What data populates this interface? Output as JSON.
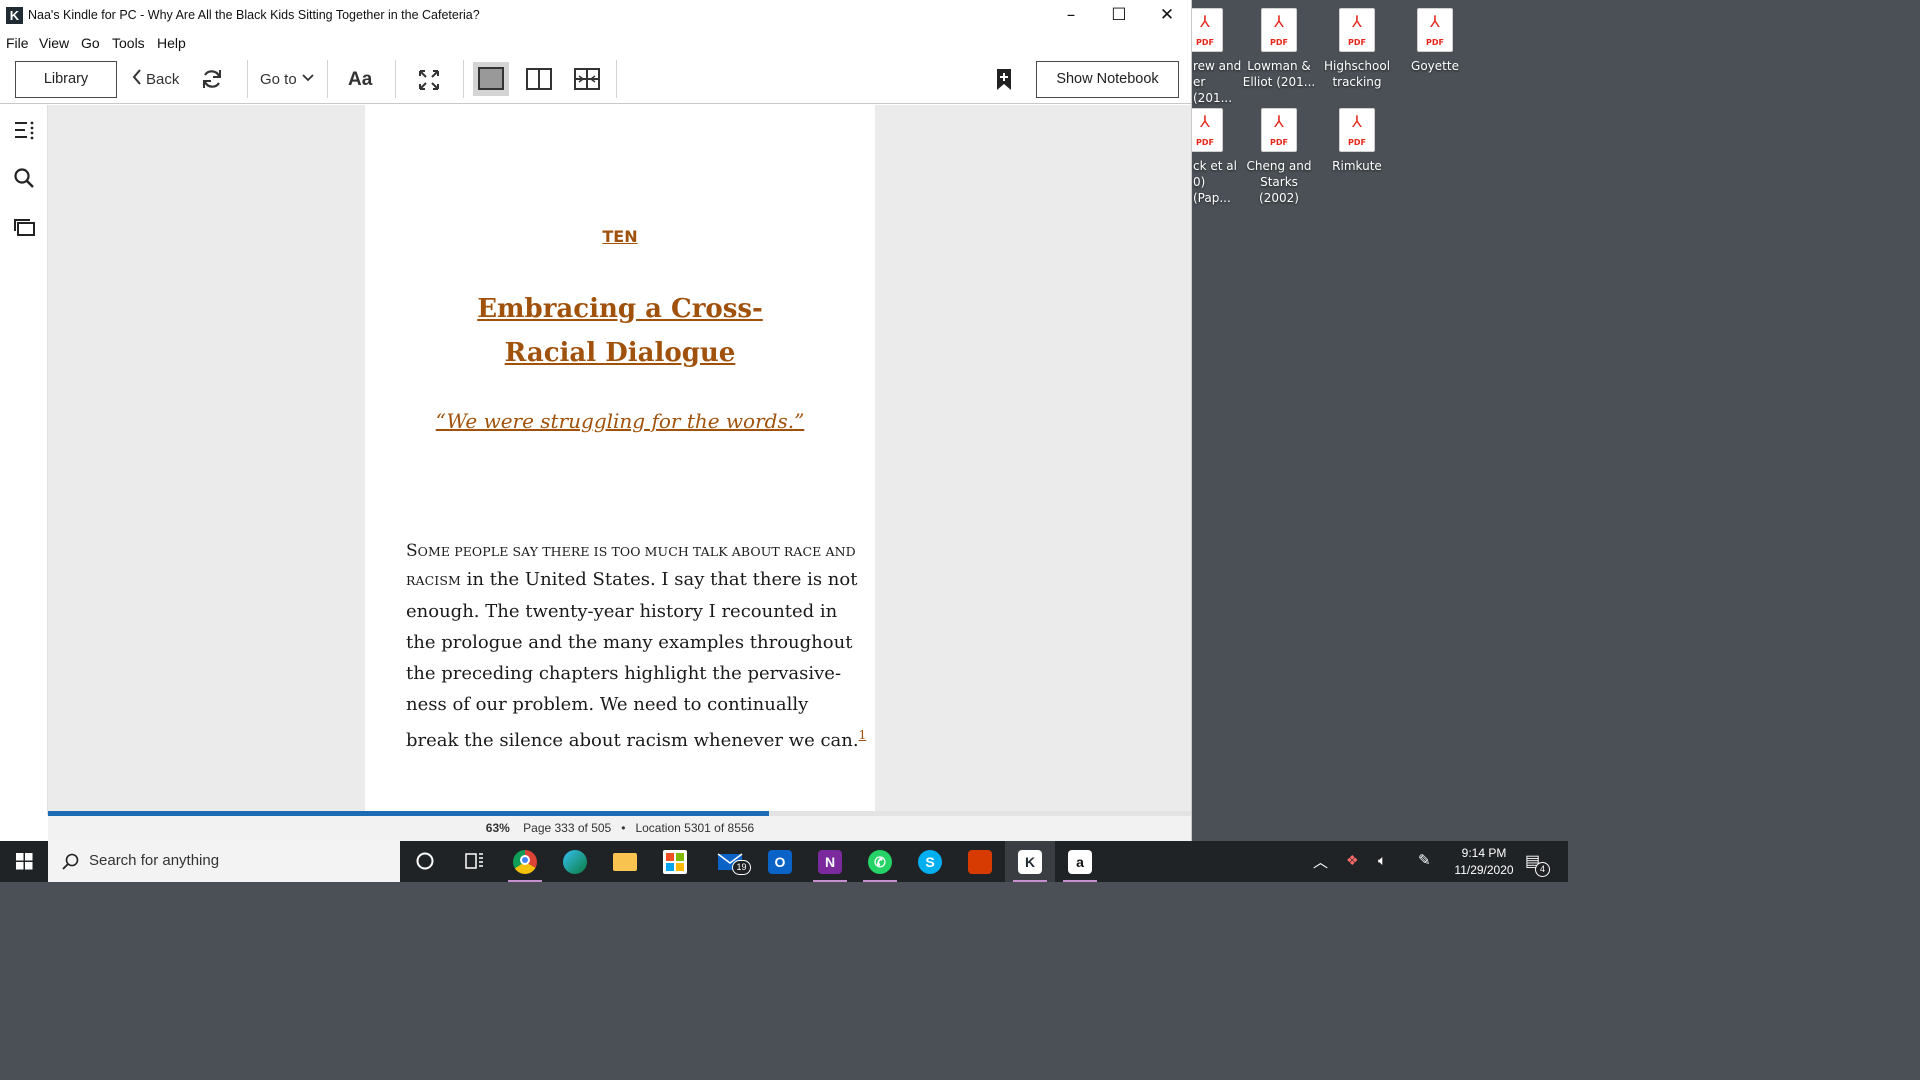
{
  "window": {
    "title": "Naa's Kindle for PC - Why Are All the Black Kids Sitting Together in the Cafeteria?",
    "app_icon": "kindle-icon"
  },
  "menu": [
    "File",
    "View",
    "Go",
    "Tools",
    "Help"
  ],
  "toolbar": {
    "library": "Library",
    "back": "Back",
    "goto": "Go to",
    "font": "Aa",
    "show_notebook": "Show Notebook"
  },
  "book": {
    "chapter_number": "TEN",
    "chapter_title_line1": "Embracing a Cross-",
    "chapter_title_line2": "Racial Dialogue",
    "epigraph": "“We were struggling for the words.”",
    "opening_first_letter": "S",
    "opening_smallcaps_1": "ome people say there is too much talk about race and",
    "opening_smallcaps_2": "racism",
    "line1_rest": " in the United States. I say that there is not",
    "line2": "enough. The twenty-year history I recounted in",
    "line3": "the prologue and the many examples throughout",
    "line4": "the preceding chapters highlight the pervasive-",
    "line5": "ness of our problem. We need to continually",
    "line6": "break the silence about racism whenever we can.",
    "footnote_ref": "1"
  },
  "status": {
    "percent": "63%",
    "percent_value": 0.63,
    "page": "Page 333 of 505",
    "separator": "•",
    "location": "Location 5301 of 8556"
  },
  "desktop_icons": [
    {
      "name": "rew and\ner (201..."
    },
    {
      "name": "Lowman &\nElliot (201..."
    },
    {
      "name": "Highschool\ntracking"
    },
    {
      "name": "Goyette"
    },
    {
      "name": "ck et al\n0) (Pap..."
    },
    {
      "name": "Cheng and\nStarks (2002)"
    },
    {
      "name": "Rimkute"
    }
  ],
  "pdf_label": "PDF",
  "taskbar": {
    "search_placeholder": "Search for anything",
    "mail_badge": "19",
    "time": "9:14 PM",
    "date": "11/29/2020",
    "notif_count": "4"
  },
  "colors": {
    "accent_heading": "#a0520c",
    "progress": "#1b6bb5",
    "taskbar": "#202326",
    "desktop": "#4a5056"
  }
}
